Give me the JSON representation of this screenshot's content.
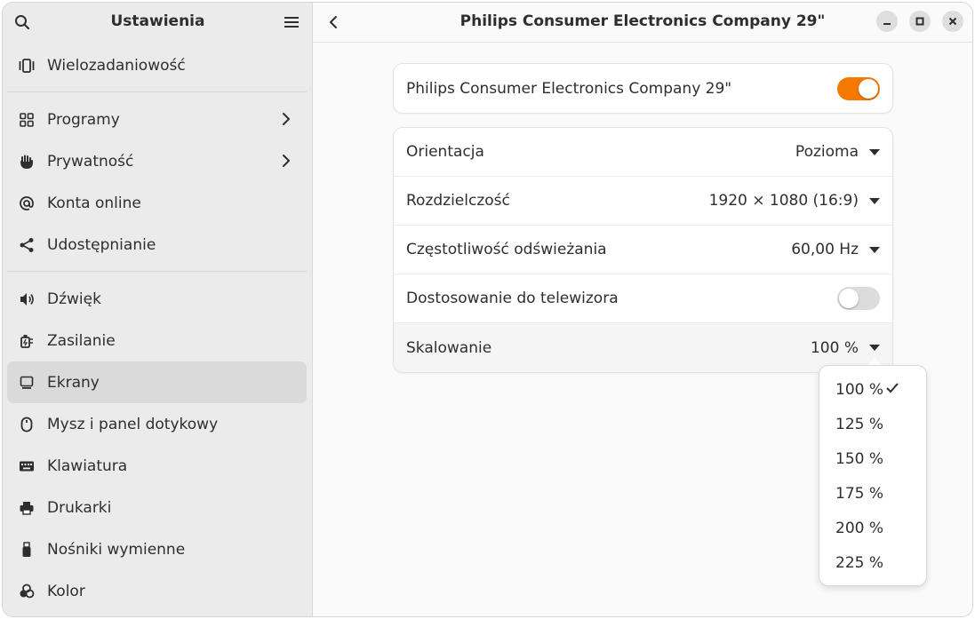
{
  "sidebar": {
    "title": "Ustawienia",
    "search_icon": "search-icon",
    "menu_icon": "hamburger-icon",
    "groups": [
      [
        {
          "label": "Wielozadaniowość",
          "icon": "multitasking-icon"
        }
      ],
      [
        {
          "label": "Programy",
          "icon": "apps-icon",
          "chevron": true
        },
        {
          "label": "Prywatność",
          "icon": "hand-icon",
          "chevron": true
        },
        {
          "label": "Konta online",
          "icon": "at-icon"
        },
        {
          "label": "Udostępnianie",
          "icon": "share-icon"
        }
      ],
      [
        {
          "label": "Dźwięk",
          "icon": "speaker-icon"
        },
        {
          "label": "Zasilanie",
          "icon": "power-icon"
        },
        {
          "label": "Ekrany",
          "icon": "display-icon",
          "active": true
        },
        {
          "label": "Mysz i panel dotykowy",
          "icon": "mouse-icon"
        },
        {
          "label": "Klawiatura",
          "icon": "keyboard-icon"
        },
        {
          "label": "Drukarki",
          "icon": "printer-icon"
        },
        {
          "label": "Nośniki wymienne",
          "icon": "usb-icon"
        },
        {
          "label": "Kolor",
          "icon": "color-icon"
        }
      ]
    ]
  },
  "main": {
    "title": "Philips Consumer Electronics Company 29\"",
    "monitor_card": {
      "label": "Philips Consumer Electronics Company 29\"",
      "enabled": true
    },
    "settings": {
      "orientation": {
        "label": "Orientacja",
        "value": "Pozioma"
      },
      "resolution": {
        "label": "Rozdzielczość",
        "value": "1920 × 1080 (16:9)"
      },
      "refresh_rate": {
        "label": "Częstotliwość odświeżania",
        "value": "60,00 Hz"
      },
      "tv_fit": {
        "label": "Dostosowanie do telewizora",
        "enabled": false
      },
      "scaling": {
        "label": "Skalowanie",
        "value": "100 %"
      }
    },
    "scaling_options": [
      "100 %",
      "125 %",
      "150 %",
      "175 %",
      "200 %",
      "225 %"
    ],
    "selected_scaling": "100 %"
  },
  "colors": {
    "accent": "#f57900",
    "sidebar_bg": "#ebebeb",
    "active_item": "#dadada"
  }
}
